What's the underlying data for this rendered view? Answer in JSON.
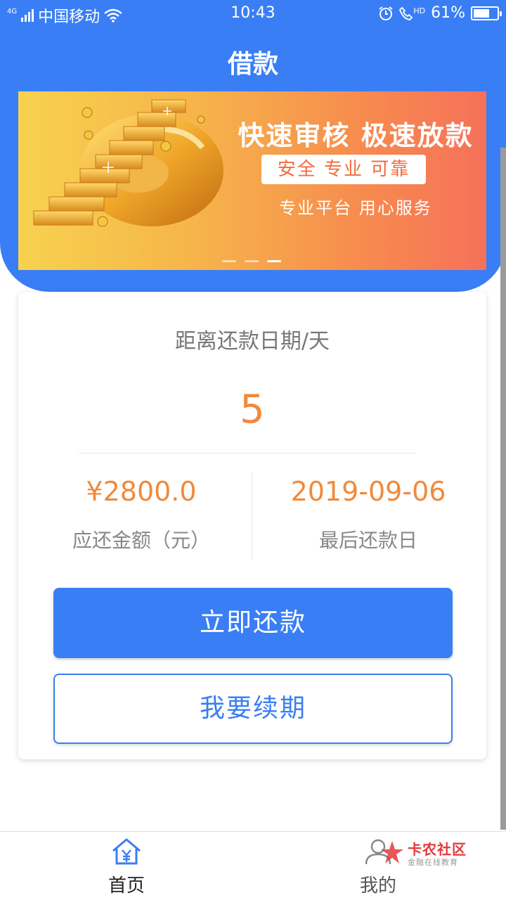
{
  "status_bar": {
    "network": "4G",
    "carrier": "中国移动",
    "time": "10:43",
    "hd": "HD",
    "battery": "61%"
  },
  "header": {
    "title": "借款"
  },
  "banner": {
    "headline": "快速审核 极速放款",
    "pill": "安全 专业 可靠",
    "subline": "专业平台 用心服务",
    "slide_count": 3,
    "active_slide": 3
  },
  "repayment": {
    "days_label": "距离还款日期/天",
    "days_value": "5",
    "amount_value": "¥2800.0",
    "amount_label": "应还金额（元）",
    "due_date_value": "2019-09-06",
    "due_date_label": "最后还款日"
  },
  "actions": {
    "repay_now": "立即还款",
    "renew": "我要续期"
  },
  "tabs": [
    {
      "label": "首页",
      "icon": "home-yuan-icon",
      "active": true
    },
    {
      "label": "我的",
      "icon": "user-icon",
      "active": false
    }
  ],
  "watermark": {
    "title": "卡农社区",
    "subtitle": "金融在线教育"
  },
  "colors": {
    "primary": "#3a7ef5",
    "accent": "#f08a3c"
  }
}
